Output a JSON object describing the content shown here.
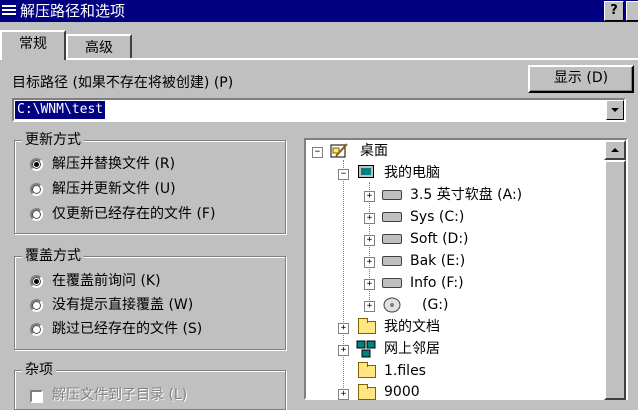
{
  "window": {
    "title": "解压路径和选项",
    "help_label": "?"
  },
  "tabs": [
    {
      "label": "常规"
    },
    {
      "label": "高级"
    }
  ],
  "path": {
    "label": "目标路径 (如果不存在将被创建) (P)",
    "value": "C:\\WNM\\test",
    "show_button": "显示 (D)"
  },
  "update_mode": {
    "title": "更新方式",
    "options": [
      {
        "label": "解压并替换文件 (R)",
        "selected": true
      },
      {
        "label": "解压并更新文件 (U)",
        "selected": false
      },
      {
        "label": "仅更新已经存在的文件 (F)",
        "selected": false
      }
    ]
  },
  "overwrite_mode": {
    "title": "覆盖方式",
    "options": [
      {
        "label": "在覆盖前询问 (K)",
        "selected": true
      },
      {
        "label": "没有提示直接覆盖 (W)",
        "selected": false
      },
      {
        "label": "跳过已经存在的文件 (S)",
        "selected": false
      }
    ]
  },
  "misc": {
    "title": "杂项",
    "items": [
      {
        "label": "解压文件到子目录 (L)",
        "checked": false
      }
    ]
  },
  "tree": {
    "nodes": [
      {
        "label": "桌面",
        "icon": "desktop-icon",
        "expander": "minus"
      },
      {
        "label": "我的电脑",
        "icon": "computer-icon",
        "expander": "minus"
      },
      {
        "label": "3.5 英寸软盘 (A:)",
        "icon": "floppy-icon",
        "expander": "plus"
      },
      {
        "label": "Sys (C:)",
        "icon": "drive-icon",
        "expander": "plus"
      },
      {
        "label": "Soft (D:)",
        "icon": "drive-icon",
        "expander": "plus"
      },
      {
        "label": "Bak (E:)",
        "icon": "drive-icon",
        "expander": "plus"
      },
      {
        "label": "Info (F:)",
        "icon": "drive-icon",
        "expander": "plus"
      },
      {
        "label": "(G:)",
        "icon": "cdrom-icon",
        "expander": "plus"
      },
      {
        "label": "我的文档",
        "icon": "folder-icon",
        "expander": "plus"
      },
      {
        "label": "网上邻居",
        "icon": "network-icon",
        "expander": "plus"
      },
      {
        "label": "1.files",
        "icon": "folder-icon",
        "expander": "none"
      },
      {
        "label": "9000",
        "icon": "folder-icon",
        "expander": "plus"
      }
    ]
  },
  "colors": {
    "titlebar": "#000080",
    "face": "#c0c0c0",
    "selection": "#000080"
  }
}
